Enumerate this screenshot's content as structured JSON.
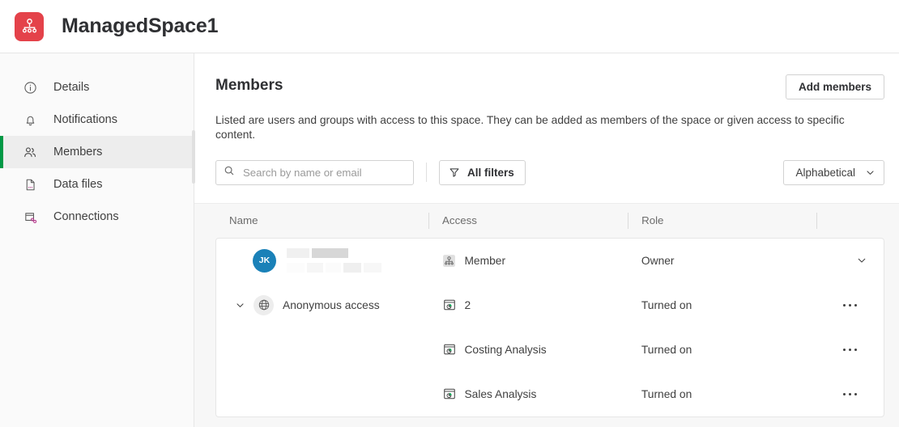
{
  "topbar": {
    "space_icon_name": "managed-space-icon",
    "space_icon_color": "#e4424a",
    "title": "ManagedSpace1"
  },
  "sidebar": {
    "accent_color": "#009845",
    "items": [
      {
        "label": "Details",
        "icon": "info-circle-icon",
        "selected": false
      },
      {
        "label": "Notifications",
        "icon": "bell-icon",
        "selected": false
      },
      {
        "label": "Members",
        "icon": "people-icon",
        "selected": true
      },
      {
        "label": "Data files",
        "icon": "document-icon",
        "selected": false
      },
      {
        "label": "Connections",
        "icon": "connections-icon",
        "selected": false
      }
    ]
  },
  "main": {
    "title": "Members",
    "add_members_label": "Add members",
    "subtitle": "Listed are users and groups with access to this space. They can be added as members of the space or given access to specific content.",
    "search": {
      "placeholder": "Search by name or email",
      "value": ""
    },
    "filters_label": "All filters",
    "sort_label": "Alphabetical",
    "columns": [
      "Name",
      "Access",
      "Role",
      ""
    ],
    "rows": [
      {
        "type": "member",
        "avatar_initials": "JK",
        "avatar_color": "#1a81b8",
        "name_redacted": true,
        "access_icon": "space-icon",
        "access": "Member",
        "role": "Owner",
        "action": "chevron-down-icon"
      },
      {
        "type": "group",
        "expanded": true,
        "icon": "globe-icon",
        "name": "Anonymous access",
        "access_icon": "app-icon",
        "access": "2",
        "role": "Turned on",
        "action": "more-options-icon"
      },
      {
        "type": "app",
        "access_icon": "app-icon",
        "access": "Costing Analysis",
        "role": "Turned on",
        "action": "more-options-icon"
      },
      {
        "type": "app",
        "access_icon": "app-icon",
        "access": "Sales Analysis",
        "role": "Turned on",
        "action": "more-options-icon"
      }
    ]
  }
}
